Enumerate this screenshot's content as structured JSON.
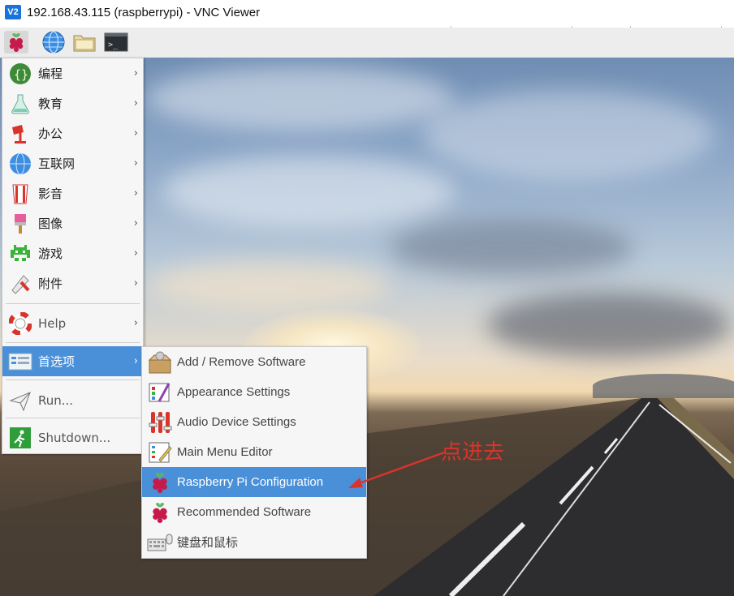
{
  "window": {
    "logo": "V2",
    "title": "192.168.43.115 (raspberrypi) - VNC Viewer"
  },
  "taskbar": {
    "icons": [
      "raspberry-menu-icon",
      "web-browser-icon",
      "file-manager-icon",
      "terminal-icon"
    ]
  },
  "menu": {
    "items": [
      {
        "label": "编程",
        "icon": "programming-icon",
        "has_submenu": true
      },
      {
        "label": "教育",
        "icon": "education-icon",
        "has_submenu": true
      },
      {
        "label": "办公",
        "icon": "office-icon",
        "has_submenu": true
      },
      {
        "label": "互联网",
        "icon": "internet-icon",
        "has_submenu": true
      },
      {
        "label": "影音",
        "icon": "sound-video-icon",
        "has_submenu": true
      },
      {
        "label": "图像",
        "icon": "graphics-icon",
        "has_submenu": true
      },
      {
        "label": "游戏",
        "icon": "games-icon",
        "has_submenu": true
      },
      {
        "label": "附件",
        "icon": "accessories-icon",
        "has_submenu": true
      },
      {
        "label": "Help",
        "icon": "help-icon",
        "has_submenu": true
      },
      {
        "label": "首选项",
        "icon": "preferences-icon",
        "has_submenu": true,
        "selected": true
      },
      {
        "label": "Run...",
        "icon": "run-icon",
        "has_submenu": false
      },
      {
        "label": "Shutdown...",
        "icon": "shutdown-icon",
        "has_submenu": false
      }
    ],
    "arrow": "›"
  },
  "submenu": {
    "items": [
      {
        "label": "Add / Remove Software",
        "icon": "add-remove-software-icon"
      },
      {
        "label": "Appearance Settings",
        "icon": "appearance-settings-icon"
      },
      {
        "label": "Audio Device Settings",
        "icon": "audio-device-settings-icon"
      },
      {
        "label": "Main Menu Editor",
        "icon": "main-menu-editor-icon"
      },
      {
        "label": "Raspberry Pi Configuration",
        "icon": "raspberry-pi-configuration-icon",
        "selected": true
      },
      {
        "label": "Recommended Software",
        "icon": "recommended-software-icon"
      },
      {
        "label": "键盘和鼠标",
        "icon": "keyboard-mouse-icon"
      }
    ]
  },
  "annotation": {
    "text": "点进去",
    "color": "#d9342b"
  },
  "colors": {
    "selection": "#4a90d9",
    "menu_bg": "#f6f6f6"
  }
}
